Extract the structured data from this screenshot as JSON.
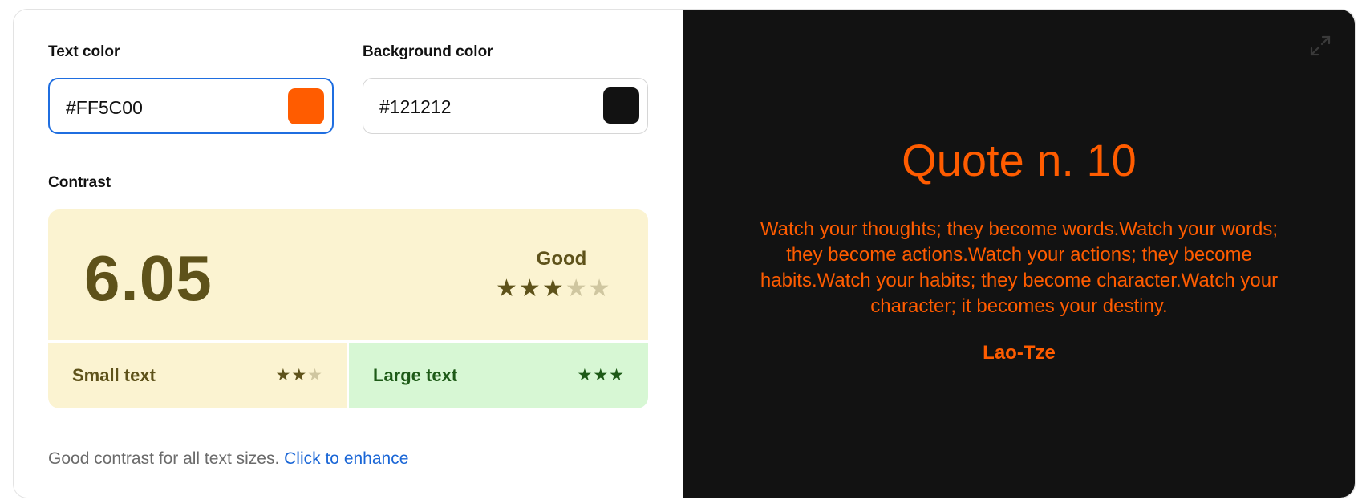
{
  "controls": {
    "text_color_label": "Text color",
    "text_color_value": "#FF5C00",
    "background_color_label": "Background color",
    "background_color_value": "#121212"
  },
  "contrast": {
    "label": "Contrast",
    "ratio": "6.05",
    "rating": "Good",
    "rating_stars": 3,
    "rating_stars_max": 5,
    "small_text_label": "Small text",
    "small_text_stars": 2,
    "small_text_stars_max": 3,
    "large_text_label": "Large text",
    "large_text_stars": 3,
    "large_text_stars_max": 3
  },
  "footer": {
    "message": "Good contrast for all text sizes.",
    "link": "Click to enhance"
  },
  "preview": {
    "title": "Quote n. 10",
    "quote": "Watch your thoughts; they become words.Watch your words; they become actions.Watch your actions; they become habits.Watch your habits; they become character.Watch your character; it becomes your destiny.",
    "author": "Lao-Tze",
    "icon": "expand-icon"
  },
  "colors": {
    "text": "#FF5C00",
    "background": "#121212",
    "accent_blue": "#1f6ee0",
    "rating_dark": "#5e521a",
    "rating_dim": "#cfc6a0",
    "large_star": "#1d5a17"
  }
}
